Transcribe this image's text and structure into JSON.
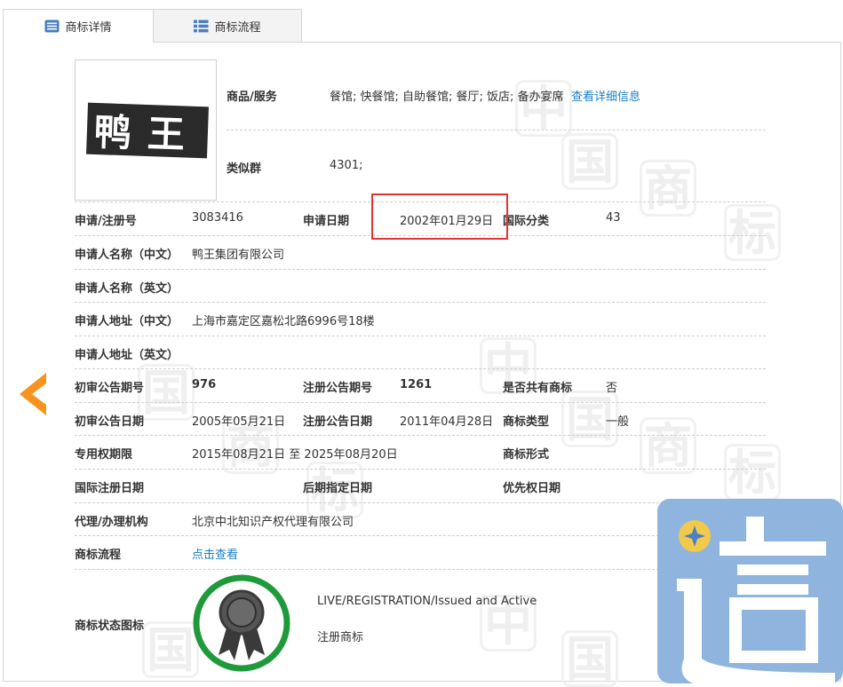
{
  "tabs": [
    {
      "label": "商标详情",
      "icon": "document-icon",
      "active": true
    },
    {
      "label": "商标流程",
      "icon": "list-icon",
      "active": false
    }
  ],
  "logo": {
    "text": "鸭王"
  },
  "goods": {
    "label": "商品/服务",
    "value": "餐馆; 快餐馆; 自助餐馆; 餐厅; 饭店; 备办宴席",
    "link": "查看详细信息"
  },
  "similar_group": {
    "label": "类似群",
    "value": "4301;"
  },
  "fields": {
    "reg_no": {
      "label": "申请/注册号",
      "value": "3083416"
    },
    "apply_date": {
      "label": "申请日期",
      "value": "2002年01月29日"
    },
    "intl_class": {
      "label": "国际分类",
      "value": "43"
    },
    "applicant_cn": {
      "label": "申请人名称（中文）",
      "value": "鸭王集团有限公司"
    },
    "applicant_en": {
      "label": "申请人名称（英文）",
      "value": ""
    },
    "address_cn": {
      "label": "申请人地址（中文）",
      "value": "上海市嘉定区嘉松北路6996号18楼"
    },
    "address_en": {
      "label": "申请人地址（英文）",
      "value": ""
    },
    "prelim_issue": {
      "label": "初审公告期号",
      "value": "976"
    },
    "reg_issue": {
      "label": "注册公告期号",
      "value": "1261"
    },
    "shared": {
      "label": "是否共有商标",
      "value": "否"
    },
    "prelim_date": {
      "label": "初审公告日期",
      "value": "2005年05月21日"
    },
    "reg_date": {
      "label": "注册公告日期",
      "value": "2011年04月28日"
    },
    "tm_type": {
      "label": "商标类型",
      "value": "一般"
    },
    "exclusive_period": {
      "label": "专用权期限",
      "value": "2015年08月21日 至 2025年08月20日"
    },
    "tm_form": {
      "label": "商标形式",
      "value": ""
    },
    "intl_reg_date": {
      "label": "国际注册日期",
      "value": ""
    },
    "later_date": {
      "label": "后期指定日期",
      "value": ""
    },
    "priority_date": {
      "label": "优先权日期",
      "value": ""
    },
    "agent": {
      "label": "代理/办理机构",
      "value": "北京中北知识产权代理有限公司"
    },
    "process": {
      "label": "商标流程",
      "value": "点击查看"
    },
    "status_icon": {
      "label": "商标状态图标",
      "status_en": "LIVE/REGISTRATION/Issued and Active",
      "status_cn": "注册商标"
    }
  },
  "watermark": {
    "chars": [
      "中",
      "国",
      "商",
      "标"
    ]
  },
  "badge": {
    "text": "這"
  },
  "colors": {
    "link": "#1a7fc4",
    "highlight": "#e53333",
    "arrow": "#f7941d",
    "status_ring": "#1e9a3a",
    "badge": "#8fb5de"
  }
}
